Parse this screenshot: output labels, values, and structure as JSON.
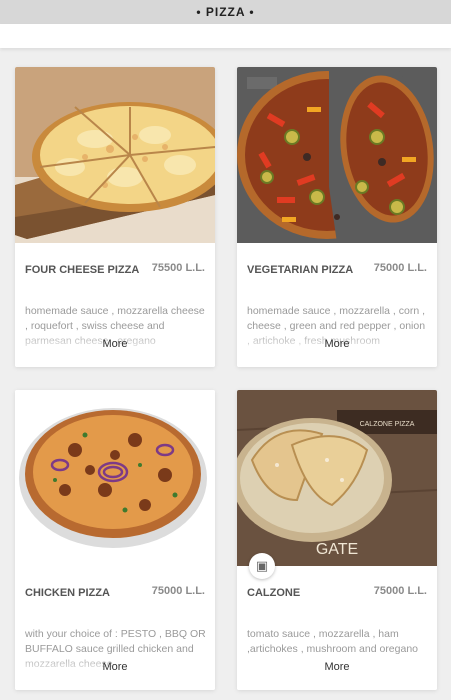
{
  "header": {
    "title": "• PIZZA •"
  },
  "items": [
    {
      "name": "FOUR CHEESE PIZZA",
      "price": "75500 L.L.",
      "description": "homemade sauce , mozzarella cheese , roquefort , swiss cheese and parmesan cheese , oregano",
      "more_label": "More"
    },
    {
      "name": "VEGETARIAN PIZZA",
      "price": "75000 L.L.",
      "description": "homemade sauce , mozzarella , corn , cheese , green and red pepper , onion , artichoke , fresh mushroom",
      "more_label": "More"
    },
    {
      "name": "CHICKEN PIZZA",
      "price": "75000 L.L.",
      "description": "with your choice of : PESTO , BBQ OR BUFFALO sauce grilled chicken and mozzarella cheese",
      "more_label": "More"
    },
    {
      "name": "CALZONE",
      "price": "75000 L.L.",
      "description": "tomato sauce , mozzarella , ham ,artichokes , mushroom and oregano",
      "more_label": "More"
    }
  ],
  "calzone_image": {
    "wood_text": "GATE",
    "box_label": "CALZONE PIZZA"
  },
  "colors": {
    "header_bg": "#d7d7d7",
    "page_bg": "#efefef",
    "card_bg": "#ffffff",
    "price_text": "#8a8a8a"
  }
}
